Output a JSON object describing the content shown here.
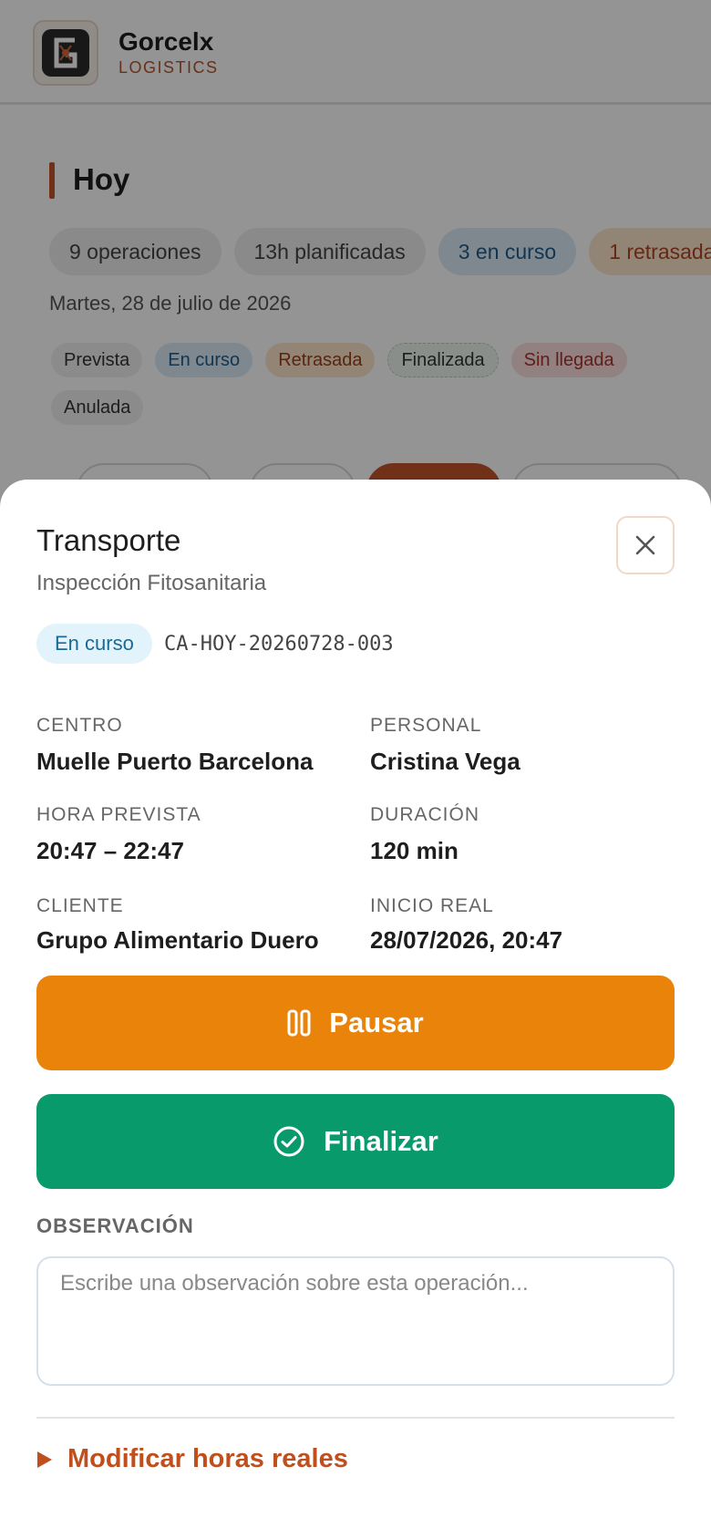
{
  "header": {
    "brand_name": "Gorcelx",
    "brand_sub": "LOGISTICS"
  },
  "today": {
    "title": "Hoy",
    "stats": [
      "9 operaciones",
      "13h planificadas",
      "3 en curso",
      "1 retrasada"
    ],
    "date": "Martes, 28 de julio de 2026",
    "legend": [
      "Prevista",
      "En curso",
      "Retrasada",
      "Finalizada",
      "Sin llegada",
      "Anulada"
    ]
  },
  "sheet": {
    "title": "Transporte",
    "subtitle": "Inspección Fitosanitaria",
    "status": "En curso",
    "code": "CA-HOY-20260728-003",
    "fields": {
      "centro_label": "CENTRO",
      "centro_value": "Muelle Puerto Barcelona",
      "personal_label": "PERSONAL",
      "personal_value": "Cristina Vega",
      "hora_label": "HORA PREVISTA",
      "hora_value": "20:47 – 22:47",
      "duracion_label": "DURACIÓN",
      "duracion_value": "120 min",
      "cliente_label": "CLIENTE",
      "cliente_value": "Grupo Alimentario Duero",
      "inicio_label": "INICIO REAL",
      "inicio_value": "28/07/2026, 20:47"
    },
    "pause_label": "Pausar",
    "finish_label": "Finalizar",
    "observation_label": "OBSERVACIÓN",
    "observation_placeholder": "Escribe una observación sobre esta operación...",
    "modify_label": "Modificar horas reales"
  },
  "colors": {
    "accent": "#c2552a",
    "pause": "#ea8309",
    "finish": "#089a6b",
    "status_bg": "#e3f3fb"
  },
  "icons": [
    "logo-icon",
    "close-icon",
    "pause-icon",
    "check-circle-icon",
    "triangle-right-icon"
  ]
}
